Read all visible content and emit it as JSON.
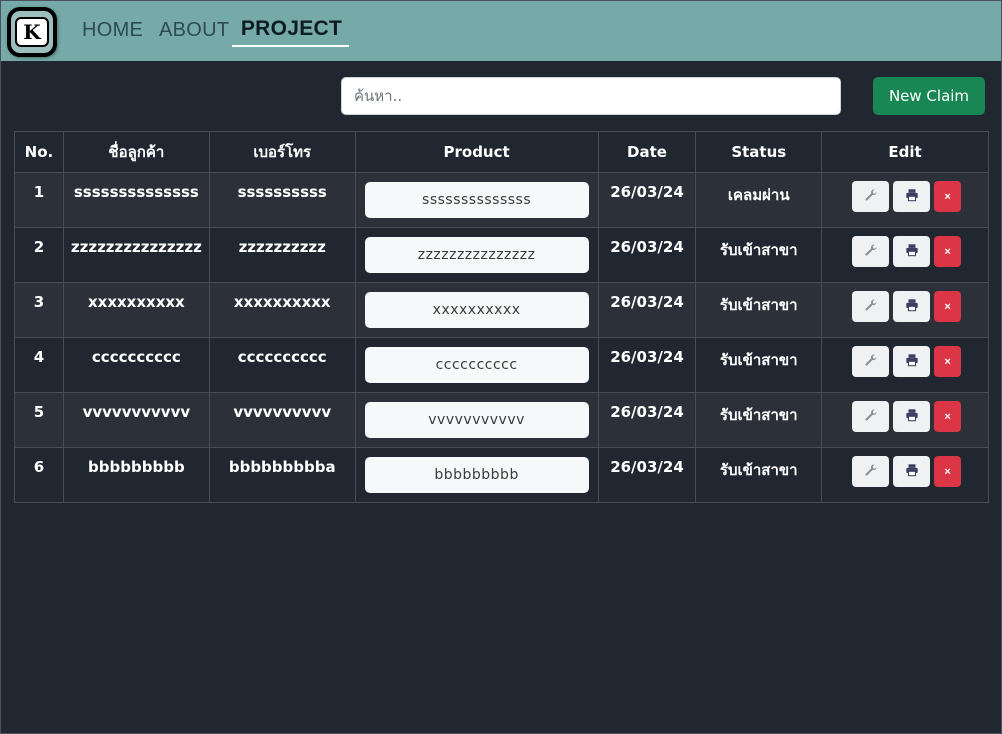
{
  "navbar": {
    "logo_letter": "K",
    "links": [
      {
        "label": "HOME"
      },
      {
        "label": "ABOUT"
      },
      {
        "label": "PROJECT"
      }
    ]
  },
  "toolbar": {
    "search_placeholder": "ค้นหา..",
    "search_value": "",
    "new_claim_label": "New Claim"
  },
  "table": {
    "headers": [
      "No.",
      "ชื่อลูกค้า",
      "เบอร์โทร",
      "Product",
      "Date",
      "Status",
      "Edit"
    ],
    "rows": [
      {
        "no": "1",
        "customer": "ssssssssssssss",
        "phone": "ssssssssss",
        "product": "ssssssssssssss",
        "date": "26/03/24",
        "status": "เคลมผ่าน"
      },
      {
        "no": "2",
        "customer": "zzzzzzzzzzzzzzz",
        "phone": "zzzzzzzzzz",
        "product": "zzzzzzzzzzzzzzz",
        "date": "26/03/24",
        "status": "รับเข้าสาขา"
      },
      {
        "no": "3",
        "customer": "xxxxxxxxxx",
        "phone": "xxxxxxxxxx",
        "product": "xxxxxxxxxx",
        "date": "26/03/24",
        "status": "รับเข้าสาขา"
      },
      {
        "no": "4",
        "customer": "cccccccccc",
        "phone": "cccccccccc",
        "product": "cccccccccc",
        "date": "26/03/24",
        "status": "รับเข้าสาขา"
      },
      {
        "no": "5",
        "customer": "vvvvvvvvvvv",
        "phone": "vvvvvvvvvv",
        "product": "vvvvvvvvvvv",
        "date": "26/03/24",
        "status": "รับเข้าสาขา"
      },
      {
        "no": "6",
        "customer": "bbbbbbbbb",
        "phone": "bbbbbbbbba",
        "product": "bbbbbbbbb",
        "date": "26/03/24",
        "status": "รับเข้าสาขา"
      }
    ],
    "edit_icons": {
      "edit": "wrench-icon",
      "print": "printer-icon",
      "delete": "close-icon"
    },
    "delete_glyph": "×"
  },
  "colors": {
    "navbar_bg": "#75aaa9",
    "page_bg": "#212731",
    "new_claim_bg": "#198754",
    "delete_bg": "#dc3545"
  }
}
